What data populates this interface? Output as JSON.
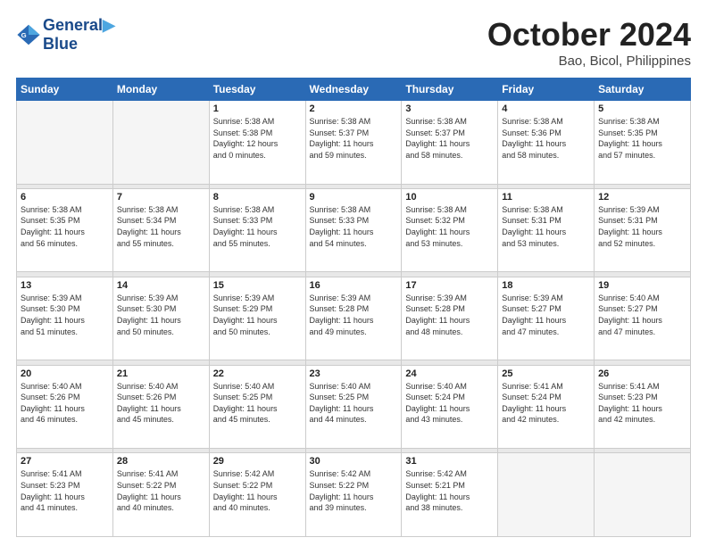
{
  "logo": {
    "line1": "General",
    "line2": "Blue"
  },
  "header": {
    "title": "October 2024",
    "subtitle": "Bao, Bicol, Philippines"
  },
  "weekdays": [
    "Sunday",
    "Monday",
    "Tuesday",
    "Wednesday",
    "Thursday",
    "Friday",
    "Saturday"
  ],
  "weeks": [
    [
      {
        "day": "",
        "info": ""
      },
      {
        "day": "",
        "info": ""
      },
      {
        "day": "1",
        "info": "Sunrise: 5:38 AM\nSunset: 5:38 PM\nDaylight: 12 hours\nand 0 minutes."
      },
      {
        "day": "2",
        "info": "Sunrise: 5:38 AM\nSunset: 5:37 PM\nDaylight: 11 hours\nand 59 minutes."
      },
      {
        "day": "3",
        "info": "Sunrise: 5:38 AM\nSunset: 5:37 PM\nDaylight: 11 hours\nand 58 minutes."
      },
      {
        "day": "4",
        "info": "Sunrise: 5:38 AM\nSunset: 5:36 PM\nDaylight: 11 hours\nand 58 minutes."
      },
      {
        "day": "5",
        "info": "Sunrise: 5:38 AM\nSunset: 5:35 PM\nDaylight: 11 hours\nand 57 minutes."
      }
    ],
    [
      {
        "day": "6",
        "info": "Sunrise: 5:38 AM\nSunset: 5:35 PM\nDaylight: 11 hours\nand 56 minutes."
      },
      {
        "day": "7",
        "info": "Sunrise: 5:38 AM\nSunset: 5:34 PM\nDaylight: 11 hours\nand 55 minutes."
      },
      {
        "day": "8",
        "info": "Sunrise: 5:38 AM\nSunset: 5:33 PM\nDaylight: 11 hours\nand 55 minutes."
      },
      {
        "day": "9",
        "info": "Sunrise: 5:38 AM\nSunset: 5:33 PM\nDaylight: 11 hours\nand 54 minutes."
      },
      {
        "day": "10",
        "info": "Sunrise: 5:38 AM\nSunset: 5:32 PM\nDaylight: 11 hours\nand 53 minutes."
      },
      {
        "day": "11",
        "info": "Sunrise: 5:38 AM\nSunset: 5:31 PM\nDaylight: 11 hours\nand 53 minutes."
      },
      {
        "day": "12",
        "info": "Sunrise: 5:39 AM\nSunset: 5:31 PM\nDaylight: 11 hours\nand 52 minutes."
      }
    ],
    [
      {
        "day": "13",
        "info": "Sunrise: 5:39 AM\nSunset: 5:30 PM\nDaylight: 11 hours\nand 51 minutes."
      },
      {
        "day": "14",
        "info": "Sunrise: 5:39 AM\nSunset: 5:30 PM\nDaylight: 11 hours\nand 50 minutes."
      },
      {
        "day": "15",
        "info": "Sunrise: 5:39 AM\nSunset: 5:29 PM\nDaylight: 11 hours\nand 50 minutes."
      },
      {
        "day": "16",
        "info": "Sunrise: 5:39 AM\nSunset: 5:28 PM\nDaylight: 11 hours\nand 49 minutes."
      },
      {
        "day": "17",
        "info": "Sunrise: 5:39 AM\nSunset: 5:28 PM\nDaylight: 11 hours\nand 48 minutes."
      },
      {
        "day": "18",
        "info": "Sunrise: 5:39 AM\nSunset: 5:27 PM\nDaylight: 11 hours\nand 47 minutes."
      },
      {
        "day": "19",
        "info": "Sunrise: 5:40 AM\nSunset: 5:27 PM\nDaylight: 11 hours\nand 47 minutes."
      }
    ],
    [
      {
        "day": "20",
        "info": "Sunrise: 5:40 AM\nSunset: 5:26 PM\nDaylight: 11 hours\nand 46 minutes."
      },
      {
        "day": "21",
        "info": "Sunrise: 5:40 AM\nSunset: 5:26 PM\nDaylight: 11 hours\nand 45 minutes."
      },
      {
        "day": "22",
        "info": "Sunrise: 5:40 AM\nSunset: 5:25 PM\nDaylight: 11 hours\nand 45 minutes."
      },
      {
        "day": "23",
        "info": "Sunrise: 5:40 AM\nSunset: 5:25 PM\nDaylight: 11 hours\nand 44 minutes."
      },
      {
        "day": "24",
        "info": "Sunrise: 5:40 AM\nSunset: 5:24 PM\nDaylight: 11 hours\nand 43 minutes."
      },
      {
        "day": "25",
        "info": "Sunrise: 5:41 AM\nSunset: 5:24 PM\nDaylight: 11 hours\nand 42 minutes."
      },
      {
        "day": "26",
        "info": "Sunrise: 5:41 AM\nSunset: 5:23 PM\nDaylight: 11 hours\nand 42 minutes."
      }
    ],
    [
      {
        "day": "27",
        "info": "Sunrise: 5:41 AM\nSunset: 5:23 PM\nDaylight: 11 hours\nand 41 minutes."
      },
      {
        "day": "28",
        "info": "Sunrise: 5:41 AM\nSunset: 5:22 PM\nDaylight: 11 hours\nand 40 minutes."
      },
      {
        "day": "29",
        "info": "Sunrise: 5:42 AM\nSunset: 5:22 PM\nDaylight: 11 hours\nand 40 minutes."
      },
      {
        "day": "30",
        "info": "Sunrise: 5:42 AM\nSunset: 5:22 PM\nDaylight: 11 hours\nand 39 minutes."
      },
      {
        "day": "31",
        "info": "Sunrise: 5:42 AM\nSunset: 5:21 PM\nDaylight: 11 hours\nand 38 minutes."
      },
      {
        "day": "",
        "info": ""
      },
      {
        "day": "",
        "info": ""
      }
    ]
  ]
}
